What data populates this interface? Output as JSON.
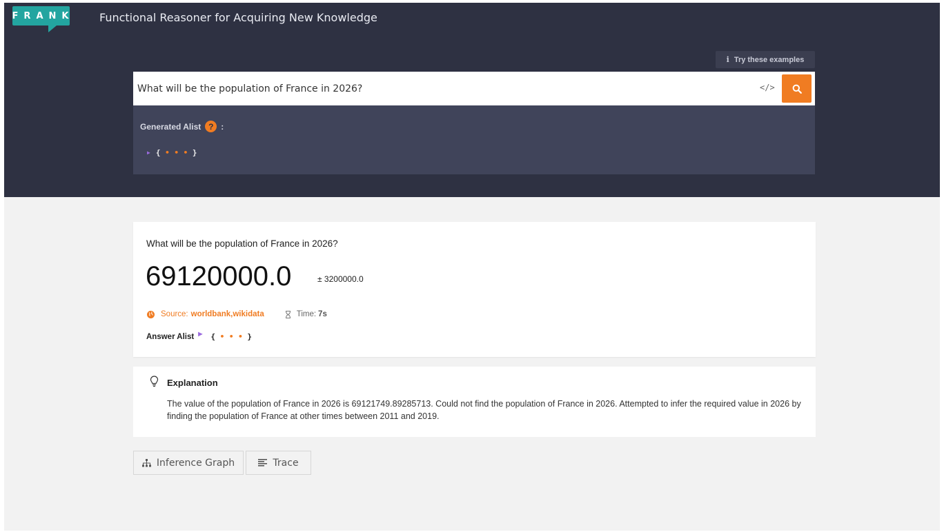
{
  "header": {
    "logo_text": "FRANK",
    "app_title": "Functional Reasoner for Acquiring New Knowledge",
    "examples_label": "Try these examples",
    "examples_icon": "i"
  },
  "search": {
    "query": "What will be the population of France in 2026?",
    "code_toggle": "</>",
    "search_icon": "search-icon"
  },
  "generated_alist": {
    "label": "Generated Alist",
    "help_icon": "?",
    "colon": ":",
    "collapsed_open": "{",
    "collapsed_dots": "• • •",
    "collapsed_close": "}"
  },
  "answer": {
    "question": "What will be the population of France in 2026?",
    "value": "69120000.0",
    "error": "± 3200000.0",
    "source_label": "Source:",
    "source_value": "worldbank,wikidata",
    "time_label": "Time:",
    "time_value": "7s",
    "alist_label": "Answer Alist",
    "alist_open": "{",
    "alist_dots": "• • •",
    "alist_close": "}"
  },
  "explanation": {
    "title": "Explanation",
    "text": "The value of the population of France in 2026 is 69121749.89285713. Could not find the population of France in 2026. Attempted to infer the required value in 2026 by finding the population of France at other times between 2011 and 2019."
  },
  "actions": {
    "inference_graph_label": "Inference Graph",
    "trace_label": "Trace"
  },
  "colors": {
    "header_bg": "#2e3142",
    "panel_bg": "#40445a",
    "accent_orange": "#f07c22",
    "logo_teal": "#23a5a0",
    "page_bg": "#f2f2f2"
  }
}
